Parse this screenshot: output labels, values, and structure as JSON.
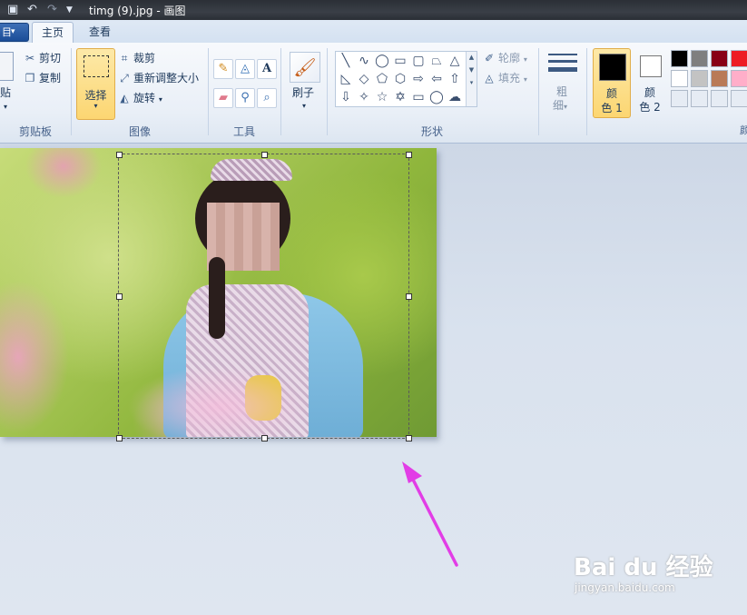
{
  "titlebar": {
    "title": "timg (9).jpg - 画图",
    "qa_icons": [
      "save-icon",
      "undo-icon",
      "redo-icon",
      "dropdown-icon"
    ]
  },
  "tabs": {
    "file_label": "目",
    "items": [
      {
        "label": "主页",
        "active": true
      },
      {
        "label": "查看",
        "active": false
      }
    ]
  },
  "ribbon": {
    "clipboard": {
      "paste": "贴",
      "cut": "剪切",
      "copy": "复制",
      "label": "剪贴板"
    },
    "image": {
      "select": "选择",
      "crop": "裁剪",
      "resize": "重新调整大小",
      "rotate": "旋转",
      "label": "图像"
    },
    "tools": {
      "label": "工具",
      "icons": [
        "pencil-icon",
        "fill-icon",
        "text-icon",
        "eraser-icon",
        "color-picker-icon",
        "magnifier-icon"
      ]
    },
    "brush": {
      "label": "刷子"
    },
    "shapes": {
      "label": "形状",
      "outline": "轮廓",
      "fill": "填充"
    },
    "size": {
      "label1": "粗",
      "label2": "细"
    },
    "colors": {
      "color1_l1": "颜",
      "color1_l2": "色 1",
      "color2_l1": "颜",
      "color2_l2": "色 2",
      "color1": "#000000",
      "color2": "#ffffff",
      "palette_row1": [
        "#000000",
        "#7f7f7f",
        "#880015",
        "#ed1c24"
      ],
      "palette_row2": [
        "#ffffff",
        "#c3c3c3",
        "#b97a57",
        "#ffaec9"
      ],
      "palette_row3": [
        "#e6ecf4",
        "#e6ecf4",
        "#e6ecf4",
        "#e6ecf4"
      ],
      "edge_label": "颜"
    }
  },
  "watermark": {
    "brand": "Bai du 经验",
    "url": "jingyan.baidu.com"
  },
  "annotation": {
    "arrow_color": "#e23de6"
  }
}
